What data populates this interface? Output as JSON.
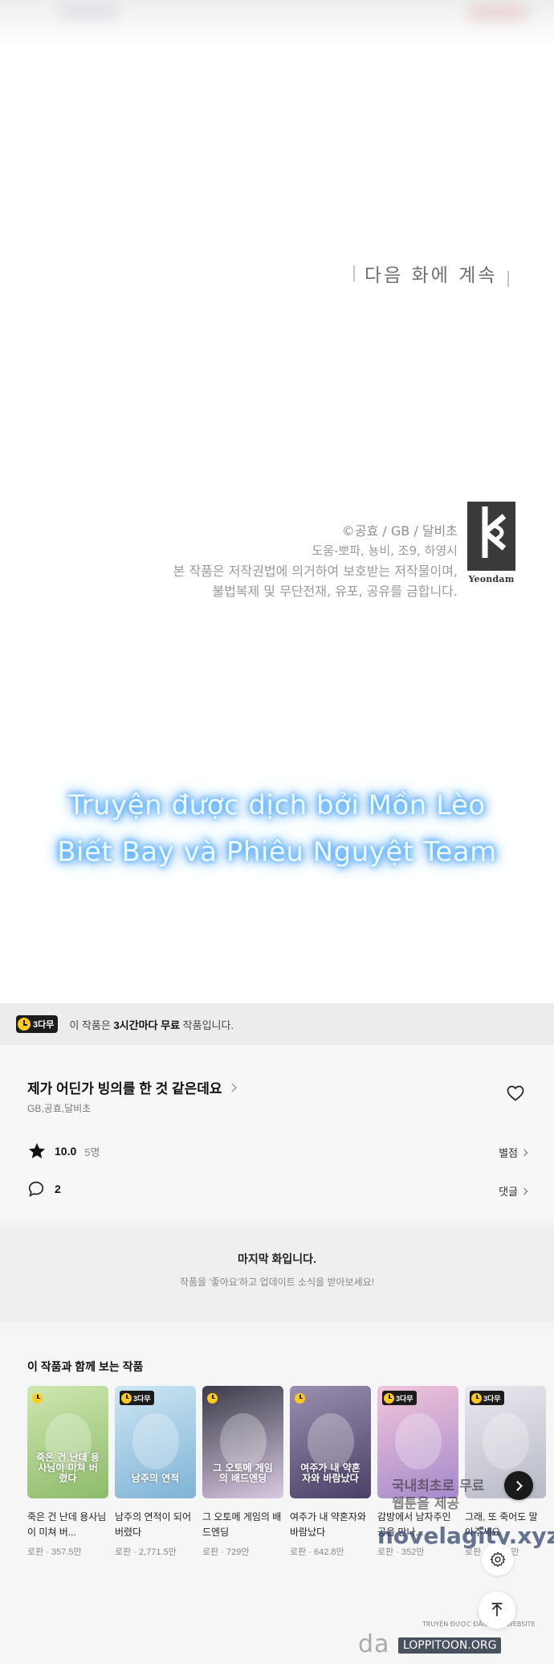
{
  "comic": {
    "next_episode": "다음 화에 계속",
    "credits": {
      "copyright": "©공효 / GB / 달비초",
      "staff": "도움-뽀파, 뇽비, 조9, 하영시",
      "notice_1": "본 작품은 저작권법에 의거하여 보호받는 저작물이며,",
      "notice_2": "불법복제 및 무단전재, 유포, 공유를 금합니다."
    },
    "publisher_logo": "Yeondam",
    "translator_line_1": "Truyện được dịch bởi Mồn Lèo",
    "translator_line_2": "Biết Bay và Phiêu Nguyệt Team"
  },
  "free_bar": {
    "badge": "3다무",
    "text_prefix": "이 작품은 ",
    "text_bold": "3시간마다 무료",
    "text_suffix": " 작품입니다."
  },
  "work": {
    "title": "제가 어딘가 빙의를 한 것 같은데요",
    "authors": "GB,공효,달비초",
    "rating": "10.0",
    "rating_count": "5명",
    "rating_link": "별점",
    "comment_count": "2",
    "comment_link": "댓글"
  },
  "last_episode": {
    "title": "마지막 화입니다.",
    "subtitle": "작품을 '좋아요'하고 업데이트 소식을 받아보세요!"
  },
  "recommendations": {
    "title": "이 작품과 함께 보는 작품",
    "items": [
      {
        "name": "죽은 건 난데 용사님이 미쳐 버...",
        "meta": "로판 · 357.5만",
        "badge": "",
        "cover_title": "죽은 건 난데 용사님이 미쳐 버렸다",
        "colors": [
          "#cfe7b0",
          "#8dbb6a"
        ]
      },
      {
        "name": "남주의 연적이 되어 버렸다",
        "meta": "로판 · 2,771.5만",
        "badge": "3다무",
        "cover_title": "남주의 연적",
        "colors": [
          "#cde6f3",
          "#7fb3d6"
        ]
      },
      {
        "name": "그 오토메 게임의 배드엔딩",
        "meta": "로판 · 729만",
        "badge": "",
        "cover_title": "그 오토메 게임의 배드엔딩",
        "colors": [
          "#3a3a48",
          "#d9c9e3"
        ]
      },
      {
        "name": "여주가 내 약혼자와 바람났다",
        "meta": "로판 · 642.8만",
        "badge": "",
        "cover_title": "여주가 내 약혼자와 바람났다",
        "colors": [
          "#9b8fb0",
          "#4b4066"
        ]
      },
      {
        "name": "감방에서 남자주인공을 만나...",
        "meta": "로판 · 352만",
        "badge": "3다무",
        "cover_title": "",
        "colors": [
          "#f2c4d9",
          "#a48acb"
        ]
      },
      {
        "name": "그래, 또 죽어도 말아주세요",
        "meta": "로판 · 2,153만",
        "badge": "3다무",
        "cover_title": "",
        "colors": [
          "#e9e9ef",
          "#b7b9c6"
        ]
      }
    ]
  },
  "watermarks": {
    "site_1": "국내최초로 무료",
    "site_2": "웹툰을 제공",
    "novel": "novelagity.xyz",
    "bottom": "da",
    "bottom_box": "LOPPITOON.ORG",
    "tiny": "TRUYỆN ĐƯỢC ĐĂNG TẠI WEBSITE"
  },
  "colors": {
    "accent_yellow": "#ffca1a",
    "badge_black": "#1c1c1c",
    "glow_blue": "#3b9cff"
  }
}
